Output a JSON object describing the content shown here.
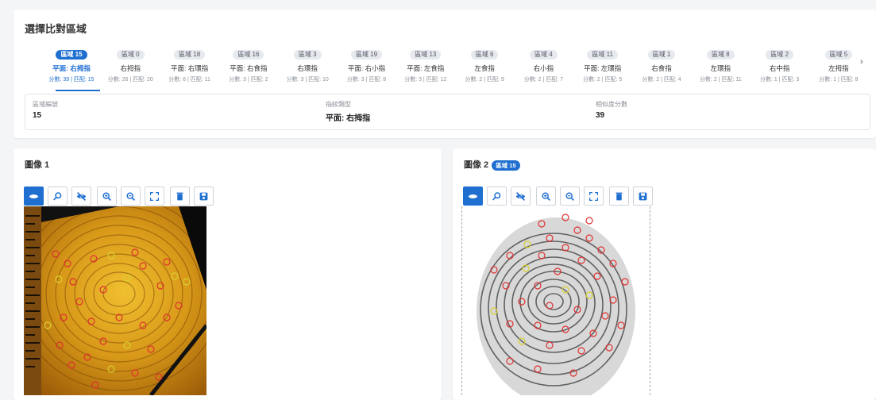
{
  "top": {
    "title": "選擇比對區域",
    "tabs": [
      {
        "region": "區域 15",
        "finger": "平面: 右拇指",
        "score": "分數: 39 | 匹配: 15",
        "active": true
      },
      {
        "region": "區域 0",
        "finger": "右拇指",
        "score": "分數: 26 | 匹配: 20"
      },
      {
        "region": "區域 18",
        "finger": "平面: 右環指",
        "score": "分數: 6 | 匹配: 11"
      },
      {
        "region": "區域 16",
        "finger": "平面: 右食指",
        "score": "分數: 3 | 匹配: 2"
      },
      {
        "region": "區域 3",
        "finger": "右環指",
        "score": "分數: 3 | 匹配: 10"
      },
      {
        "region": "區域 19",
        "finger": "平面: 右小指",
        "score": "分數: 3 | 匹配: 8"
      },
      {
        "region": "區域 13",
        "finger": "平面: 左食指",
        "score": "分數: 3 | 匹配: 12"
      },
      {
        "region": "區域 6",
        "finger": "左食指",
        "score": "分數: 2 | 匹配: 9"
      },
      {
        "region": "區域 4",
        "finger": "右小指",
        "score": "分數: 2 | 匹配: 7"
      },
      {
        "region": "區域 11",
        "finger": "平面: 左環指",
        "score": "分數: 2 | 匹配: 5"
      },
      {
        "region": "區域 1",
        "finger": "右食指",
        "score": "分數: 2 | 匹配: 4"
      },
      {
        "region": "區域 8",
        "finger": "左環指",
        "score": "分數: 2 | 匹配: 11"
      },
      {
        "region": "區域 2",
        "finger": "右中指",
        "score": "分數: 1 | 匹配: 3"
      },
      {
        "region": "區域 5",
        "finger": "左拇指",
        "score": "分數: 1 | 匹配: 8"
      }
    ],
    "next_icon": "chevron-right-icon",
    "info": {
      "region_label": "區域編號",
      "region_value": "15",
      "type_label": "指紋類型",
      "type_value": "平面: 右拇指",
      "score_label": "相似度分數",
      "score_value": "39"
    }
  },
  "image1": {
    "title": "圖像 1"
  },
  "image2": {
    "title": "圖像 2",
    "badge": "區域 15"
  },
  "toolbar_icons": [
    "eye-icon",
    "search-icon",
    "eye-off-icon",
    "zoom-in-icon",
    "zoom-out-icon",
    "fullscreen-icon",
    "trash-icon",
    "save-icon"
  ],
  "colors": {
    "accent": "#1f6fd1",
    "minutia_red": "#e03030",
    "minutia_yellow": "#d8d030"
  }
}
